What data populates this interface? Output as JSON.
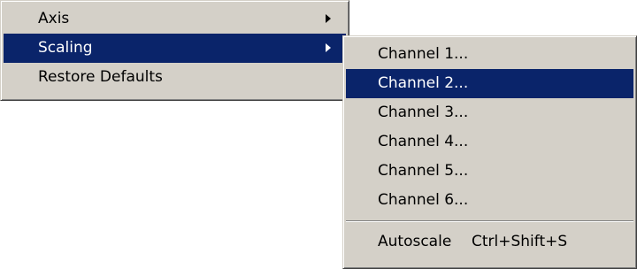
{
  "main_menu": {
    "items": [
      {
        "label": "Axis",
        "has_submenu": true,
        "selected": false
      },
      {
        "label": "Scaling",
        "has_submenu": true,
        "selected": true
      },
      {
        "label": "Restore Defaults",
        "has_submenu": false,
        "selected": false
      }
    ]
  },
  "scaling_submenu": {
    "items": [
      {
        "label": "Channel 1...",
        "selected": false
      },
      {
        "label": "Channel 2...",
        "selected": true
      },
      {
        "label": "Channel 3...",
        "selected": false
      },
      {
        "label": "Channel 4...",
        "selected": false
      },
      {
        "label": "Channel 5...",
        "selected": false
      },
      {
        "label": "Channel 6...",
        "selected": false
      }
    ],
    "autoscale": {
      "label": "Autoscale",
      "shortcut": "Ctrl+Shift+S"
    }
  },
  "colors": {
    "menu_background": "#d4d0c8",
    "selection_background": "#0a246a",
    "selection_text": "#ffffff",
    "text": "#000000"
  },
  "icons": {
    "submenu_arrow": "chevron-right-icon"
  }
}
